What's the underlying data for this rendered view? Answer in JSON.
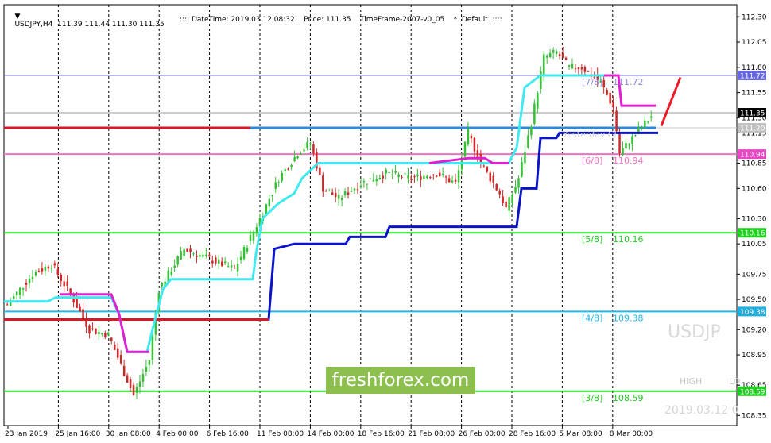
{
  "window": {
    "symbol_header": "USDJPY,H4  111.39 111.44 111.30 111.35",
    "info_line": ":::: DateTime: 2019.03.12 08:32    Price: 111.35    TimeFrame-2007-v0_05    *  Default  ::::",
    "watermark_symbol": "USDJP",
    "watermark_high": "HIGH",
    "watermark_low": "LO",
    "watermark_date": "2019.03.12 0",
    "brand": "freshforex.com",
    "yesterday_label": "Yesterday Cl"
  },
  "colors": {
    "bull": "#35c035",
    "bear": "#d02828",
    "cyan": "#40e8f0",
    "navy": "#0a14c8",
    "magenta": "#e020d0",
    "red": "#d21a28",
    "blue_line": "#2e8ad8"
  },
  "chart_data": {
    "type": "candlestick",
    "price_axis": {
      "ylim": [
        108.25,
        112.42
      ],
      "ticks": [
        "112.30",
        "112.05",
        "111.80",
        "111.55",
        "111.30",
        "111.15",
        "110.85",
        "110.60",
        "110.30",
        "110.05",
        "109.75",
        "109.50",
        "109.20",
        "108.95",
        "108.65",
        "108.35"
      ]
    },
    "time_axis": {
      "labels": [
        "23 Jan 2019",
        "25 Jan 16:00",
        "30 Jan 08:00",
        "4 Feb 00:00",
        "6 Feb 16:00",
        "11 Feb 08:00",
        "14 Feb 00:00",
        "18 Feb 16:00",
        "21 Feb 08:00",
        "26 Feb 00:00",
        "28 Feb 16:00",
        "5 Mar 08:00",
        "8 Mar 00:00"
      ]
    },
    "murrey_levels": [
      {
        "name": "[7/8]",
        "price": 111.72,
        "tag": "111.72",
        "color": "#7070e0",
        "text_color": "#8a8ae0",
        "box": "#6868e0"
      },
      {
        "name": "[6/8]",
        "price": 110.94,
        "tag": "110.94",
        "color": "#f070c0",
        "text_color": "#f070c0",
        "box": "#e848c8"
      },
      {
        "name": "[5/8]",
        "price": 110.16,
        "tag": "110.16",
        "color": "#22dd22",
        "text_color": "#22cc22",
        "box": "#20d020"
      },
      {
        "name": "[4/8]",
        "price": 109.38,
        "tag": "109.38",
        "color": "#20b8e8",
        "text_color": "#20b8e8",
        "box": "#20b0e0"
      },
      {
        "name": "[3/8]",
        "price": 108.59,
        "tag": "108.59",
        "color": "#22dd22",
        "text_color": "#22cc22",
        "box": "#20d020"
      }
    ],
    "other_levels": [
      {
        "name": "current",
        "price": 111.35,
        "tag": "111.35",
        "box": "#000000"
      },
      {
        "name": "yesterday-close",
        "price": 111.2,
        "tag": "111.20",
        "box": "#c0c0c0"
      }
    ]
  }
}
